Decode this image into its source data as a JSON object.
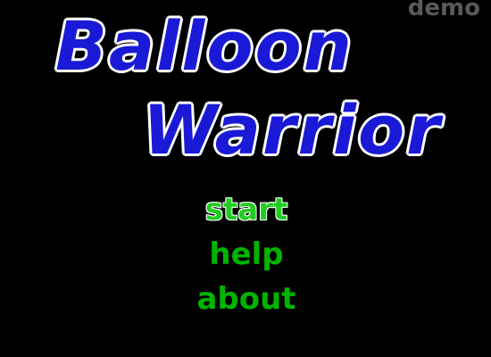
{
  "badge": {
    "text": "demo"
  },
  "title": {
    "line1": "Balloon",
    "line2": "Warrior",
    "color": "#1a1ad6",
    "outline_color": "#ffffff"
  },
  "menu": {
    "items": [
      {
        "label": "start",
        "selected": true
      },
      {
        "label": "help",
        "selected": false
      },
      {
        "label": "about",
        "selected": false
      }
    ],
    "color": "#00b400"
  },
  "background_color": "#000000"
}
